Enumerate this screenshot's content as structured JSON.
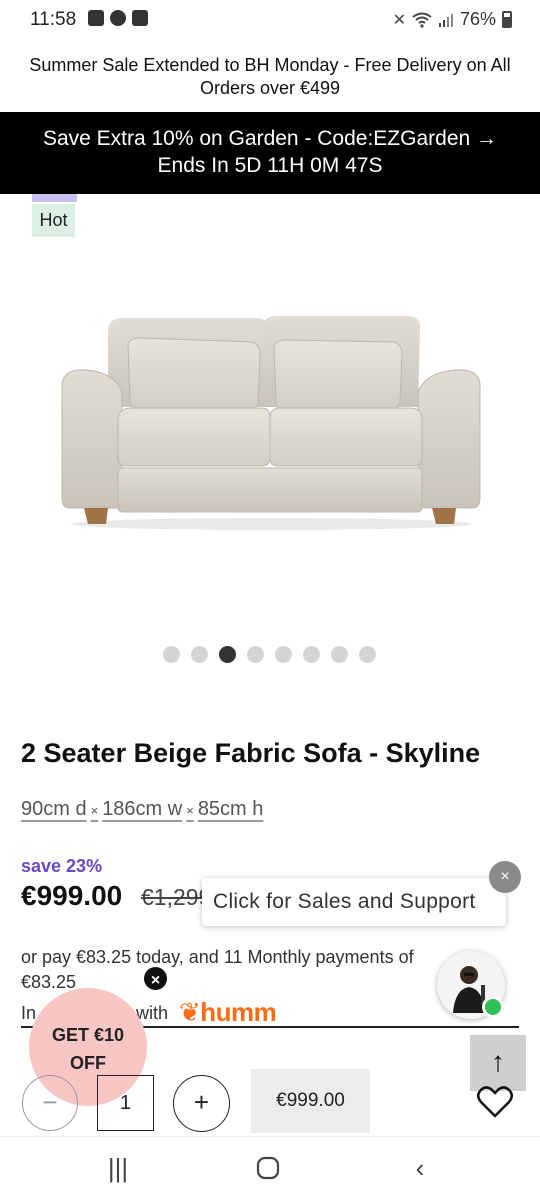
{
  "status_bar": {
    "time": "11:58",
    "battery": "76%",
    "icons": [
      "gallery-icon",
      "chat-icon",
      "screen-record-icon",
      "mute-icon",
      "wifi-icon",
      "signal-icon",
      "battery-icon"
    ]
  },
  "promo": {
    "text": "Summer Sale Extended to BH Monday - Free Delivery on All Orders over €499"
  },
  "sale_banner": {
    "line1": "Save Extra 10% on Garden - Code:EZGarden →",
    "line2": "Ends In 5D 11H 0M 47S"
  },
  "product": {
    "badge": "Hot",
    "title": "2 Seater Beige Fabric Sofa - Skyline",
    "dims": {
      "depth": "90cm d",
      "width": "186cm w",
      "height": "85cm h",
      "separator": "×"
    },
    "save": "save 23%",
    "price": "€999.00",
    "old_price": "€1,299.00",
    "image_count": 8,
    "active_image": 3
  },
  "support": {
    "text": "Click for Sales and Support",
    "close": "×"
  },
  "finance": {
    "text": "or pay €83.25 today, and 11 Monthly payments of €83.25",
    "prefix": "In",
    "with": "with",
    "provider": "humm"
  },
  "coupon": {
    "line1": "GET €10",
    "line2": "OFF",
    "close": "×"
  },
  "cart": {
    "minus": "−",
    "quantity": "1",
    "plus": "+",
    "price_button": "€999.00",
    "back_to_top": "↑"
  },
  "colors": {
    "save_text": "#6a48c8",
    "banner_bg": "#000000",
    "coupon_bg": "#f8c5c5",
    "humm_orange": "#ff6b12",
    "hot_badge_bg": "#dcefe5",
    "online": "#2fbf55"
  },
  "nav_bar": {
    "recents": "|||",
    "home": "○",
    "back": "‹"
  }
}
